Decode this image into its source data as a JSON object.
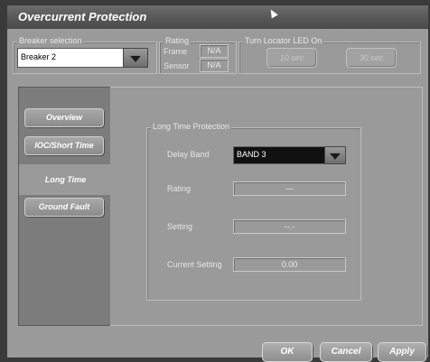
{
  "window": {
    "title": "Overcurrent Protection"
  },
  "breaker": {
    "caption": "Breaker selection",
    "value": "Breaker 2"
  },
  "rating": {
    "caption": "Rating",
    "frame_label": "Frame",
    "frame_value": "N/A",
    "sensor_label": "Sensor",
    "sensor_value": "N/A"
  },
  "locator": {
    "caption": "Turn Locator LED On",
    "btn1": "10 sec",
    "btn2": "30 sec"
  },
  "tabs": [
    "Overview",
    "IOC/Short Time",
    "Long Time",
    "Ground Fault"
  ],
  "long_time": {
    "caption": "Long Time Protection",
    "delay_band_label": "Delay Band",
    "delay_band_value": "BAND 3",
    "rating_label": "Rating",
    "rating_value": "---",
    "setting_label": "Setting",
    "setting_value": "--.-",
    "current_setting_label": "Current Setting",
    "current_setting_value": "0.00"
  },
  "buttons": {
    "ok": "OK",
    "cancel": "Cancel",
    "apply": "Apply"
  }
}
